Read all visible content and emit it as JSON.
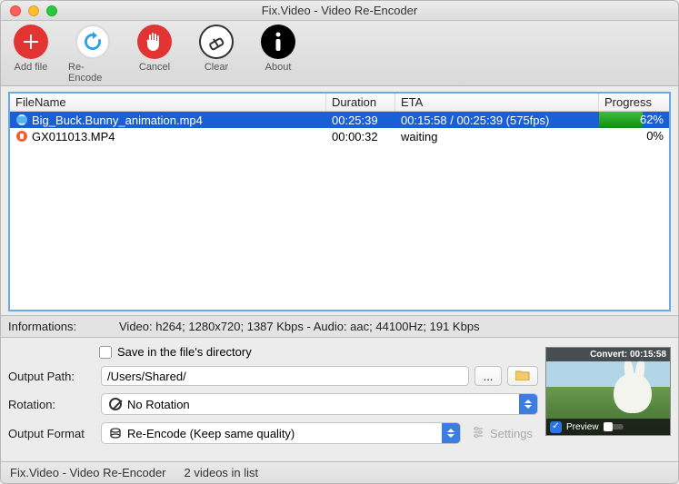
{
  "window": {
    "title": "Fix.Video - Video Re-Encoder"
  },
  "toolbar": {
    "add": "Add file",
    "reencode": "Re-Encode",
    "cancel": "Cancel",
    "clear": "Clear",
    "about": "About"
  },
  "table": {
    "headers": {
      "filename": "FileName",
      "duration": "Duration",
      "eta": "ETA",
      "progress": "Progress"
    },
    "rows": [
      {
        "filename": "Big_Buck.Bunny_animation.mp4",
        "duration": "00:25:39",
        "eta": "00:15:58 / 00:25:39 (575fps)",
        "progress_pct": 62,
        "progress_text": "62%",
        "selected": true
      },
      {
        "filename": "GX011013.MP4",
        "duration": "00:00:32",
        "eta": "waiting",
        "progress_pct": 0,
        "progress_text": "0%",
        "selected": false
      }
    ]
  },
  "info": {
    "label": "Informations:",
    "text": "Video: h264; 1280x720; 1387 Kbps - Audio: aac; 44100Hz; 191 Kbps"
  },
  "form": {
    "save_in_dir": "Save in the file's directory",
    "output_path_label": "Output Path:",
    "output_path_value": "/Users/Shared/",
    "browse": "...",
    "rotation_label": "Rotation:",
    "rotation_value": "No Rotation",
    "format_label": "Output Format",
    "format_value": "Re-Encode (Keep same quality)",
    "settings": "Settings"
  },
  "preview": {
    "overlay": "Convert: 00:15:58",
    "checkbox_label": "Preview"
  },
  "status": {
    "app": "Fix.Video - Video Re-Encoder",
    "count": "2 videos in list"
  }
}
